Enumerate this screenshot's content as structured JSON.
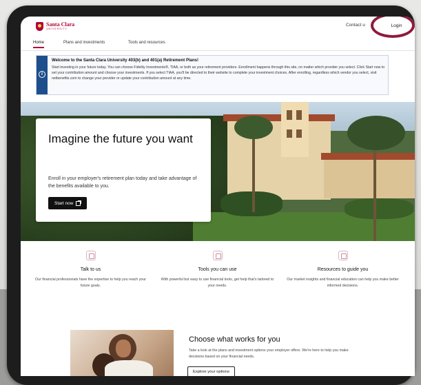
{
  "header": {
    "logo_name": "Santa Clara",
    "logo_sub": "UNIVERSITY",
    "contact_label": "Contact u",
    "login_label": "Login"
  },
  "tabs": [
    {
      "label": "Home",
      "active": true
    },
    {
      "label": "Plans and investments",
      "active": false
    },
    {
      "label": "Tools and resources",
      "active": false
    }
  ],
  "banner": {
    "icon": "info-icon",
    "title": "Welcome to the Santa Clara University 403(b) and 401(a) Retirement Plans!",
    "text": "Start investing in your future today. You can choose Fidelity Investments®, TIAA, or both as your retirement providers. Enrollment happens through this site, no matter which provider you select. Click Start now to set your contribution amount and choose your investments. If you select TIAA, you'll be directed to their website to complete your investment choices. After enrolling, regardless which vendor you select, visit netbenefits.com to change your provider or update your contribution amount at any time."
  },
  "hero": {
    "title": "Imagine the future you want",
    "text": "Enroll in your employer's retirement plan today and take advantage of the benefits available to you.",
    "button_label": "Start now"
  },
  "features": [
    {
      "icon": "chat-icon",
      "title": "Talk to us",
      "text": "Our financial professionals have the expertise to help you reach your future goals."
    },
    {
      "icon": "tools-icon",
      "title": "Tools you can use",
      "text": "With powerful but easy to use financial tools, get help that's tailored to your needs."
    },
    {
      "icon": "resources-icon",
      "title": "Resources to guide you",
      "text": "Our market insights and financial education can help you make better informed decisions."
    }
  ],
  "choose": {
    "title": "Choose what works for you",
    "text": "Take a look at the plans and investment options your employer offers. We're here to help you make decisions based on your financial needs.",
    "button_label": "Explore your options"
  },
  "colors": {
    "brand": "#b30738",
    "banner_accent": "#1f4e8c",
    "highlight_ring": "#8e1b3d"
  }
}
